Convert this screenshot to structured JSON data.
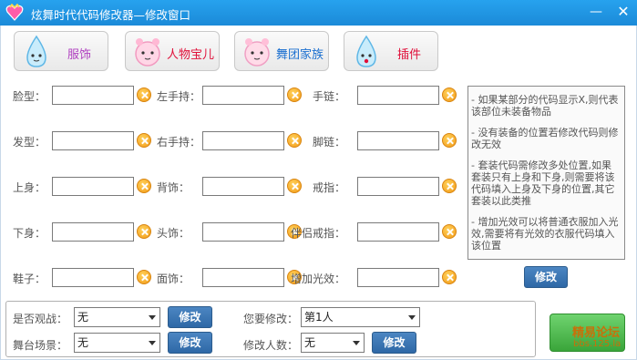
{
  "window": {
    "title": "炫舞时代代码修改器—修改窗口",
    "minimize_glyph": "—",
    "close_glyph": "✕"
  },
  "tabs": [
    {
      "label": "服饰",
      "color": "#b040c0",
      "icon": "water-drop-icon"
    },
    {
      "label": "人物宝儿",
      "color": "#e0103a",
      "icon": "pink-mascot-icon"
    },
    {
      "label": "舞团家族",
      "color": "#1a6fd0",
      "icon": "pink-mascot-icon"
    },
    {
      "label": "插件",
      "color": "#e0103a",
      "icon": "water-drop-icon"
    }
  ],
  "fields": {
    "col1": [
      {
        "label": "脸型：",
        "value": ""
      },
      {
        "label": "发型：",
        "value": ""
      },
      {
        "label": "上身：",
        "value": ""
      },
      {
        "label": "下身：",
        "value": ""
      },
      {
        "label": "鞋子：",
        "value": ""
      }
    ],
    "col2": [
      {
        "label": "左手持：",
        "value": ""
      },
      {
        "label": "右手持：",
        "value": ""
      },
      {
        "label": "背饰：",
        "value": ""
      },
      {
        "label": "头饰：",
        "value": ""
      },
      {
        "label": "面饰：",
        "value": ""
      }
    ],
    "col3": [
      {
        "label": "手链：",
        "value": ""
      },
      {
        "label": "脚链：",
        "value": ""
      },
      {
        "label": "戒指：",
        "value": ""
      },
      {
        "label": "伴侣戒指：",
        "value": ""
      },
      {
        "label": "增加光效：",
        "value": ""
      }
    ]
  },
  "notes": [
    "- 如果某部分的代码显示X,则代表该部位未装备物品",
    "- 没有装备的位置若修改代码则修改无效",
    "- 套装代码需修改多处位置,如果套装只有上身和下身,则需要将该代码填入上身及下身的位置,其它套装以此类推",
    "- 增加光效可以将普通衣服加入光效,需要将有光效的衣服代码填入该位置"
  ],
  "modify_label": "修改",
  "bottom": {
    "spectate": {
      "label": "是否观战：",
      "value": "无"
    },
    "stage": {
      "label": "舞台场景：",
      "value": "无"
    },
    "target": {
      "label": "您要修改：",
      "value": "第1人"
    },
    "count": {
      "label": "修改人数：",
      "value": "无"
    }
  },
  "forum": {
    "name": "精易论坛",
    "url": "bbs.125.la"
  },
  "colors": {
    "titlebar": "#1e90e0",
    "button": "#3a74b4",
    "clear_icon": "#f5a623"
  }
}
